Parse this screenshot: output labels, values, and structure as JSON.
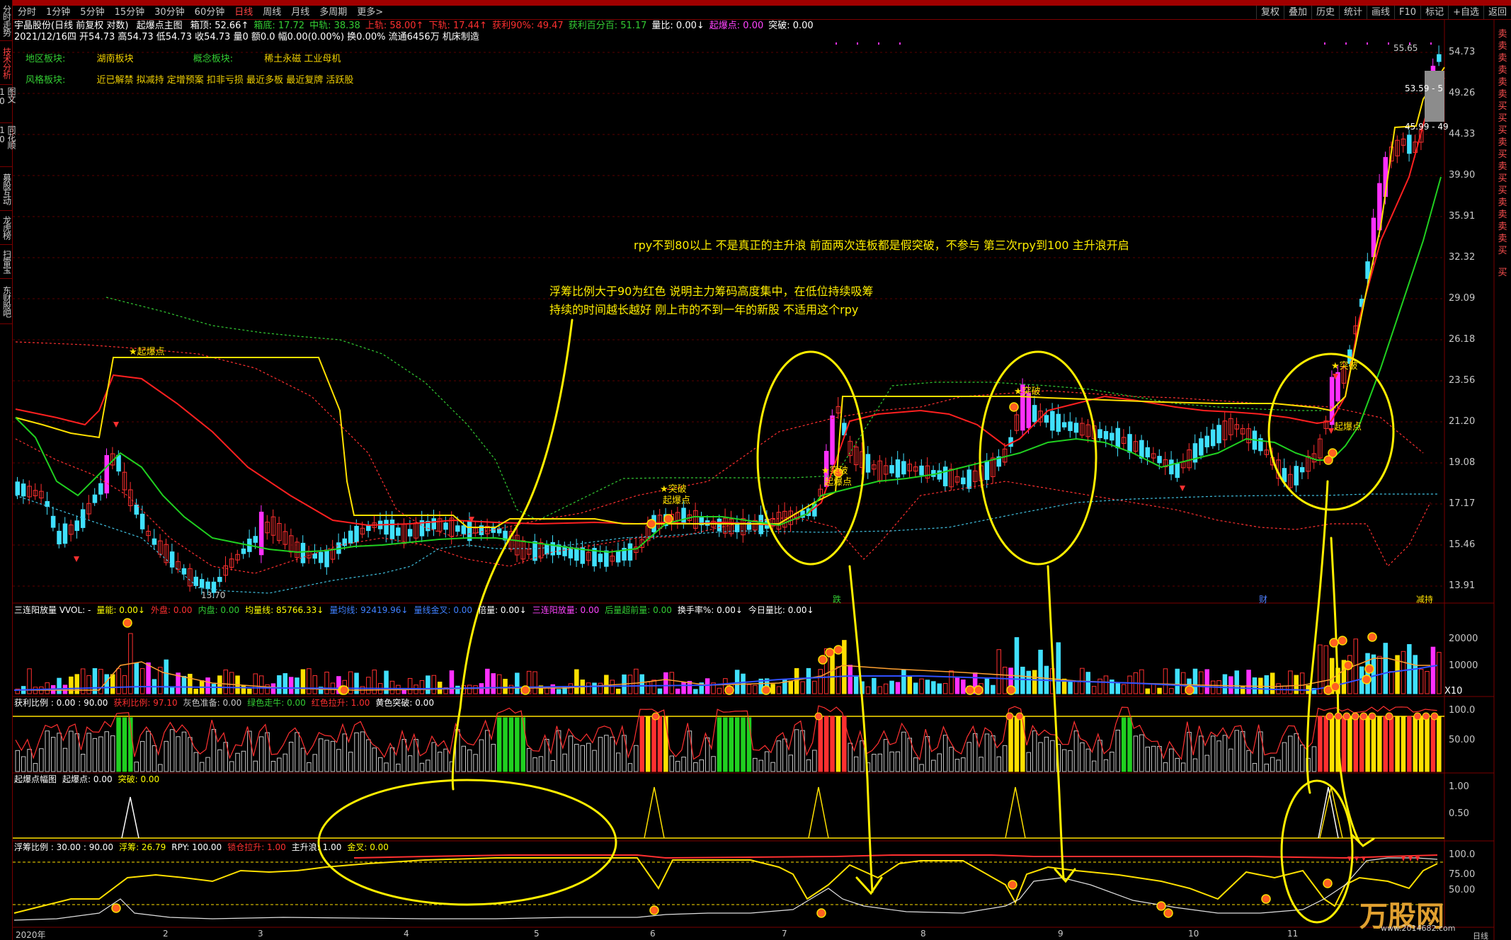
{
  "left_tabs": [
    "分时走势",
    "技术分析",
    "图文10",
    "同花顺10",
    "募股互动",
    "龙虎榜",
    "扫雷宝",
    "东财股吧"
  ],
  "periods": [
    "分时",
    "1分钟",
    "5分钟",
    "15分钟",
    "30分钟",
    "60分钟",
    "日线",
    "周线",
    "月线",
    "多周期",
    "更多>"
  ],
  "active_period": "日线",
  "tools": [
    "复权",
    "叠加",
    "历史",
    "统计",
    "画线",
    "F10",
    "标记",
    "+自选",
    "返回"
  ],
  "stock_line": {
    "name": "宇晶股份(日线 前复权 对数)",
    "indicator": "起爆点主图",
    "items": [
      {
        "text": "箱顶: 52.66↑",
        "color": "#ffffff"
      },
      {
        "text": "箱底: 17.72",
        "color": "#33cc33"
      },
      {
        "text": "中轨: 38.38",
        "color": "#33cc33"
      },
      {
        "text": "上轨: 58.00↑",
        "color": "#ff3030"
      },
      {
        "text": "下轨: 17.44↑",
        "color": "#ff3030"
      },
      {
        "text": "获利90%: 49.47",
        "color": "#ff3030"
      },
      {
        "text": "获利百分百: 51.17",
        "color": "#33cc33"
      },
      {
        "text": "量比: 0.00↓",
        "color": "#ffffff"
      },
      {
        "text": "起爆点: 0.00",
        "color": "#ff44ff"
      },
      {
        "text": "突破: 0.00",
        "color": "#ffffff"
      }
    ]
  },
  "quote_line": "2021/12/16四 开54.73 高54.73 低54.73 收54.73 量0 额0.0 幅0.00(0.00%) 换0.00% 流通6456万 机床制造",
  "sectors": {
    "region_label": "地区板块:",
    "region": "湖南板块",
    "concept_label": "概念板块:",
    "concept": "稀土永磁 工业母机",
    "style_label": "风格板块:",
    "style": "近已解禁 拟减持 定增预案 扣非亏损 最近多板 最近复牌 活跃股"
  },
  "annotations": {
    "a1": "rpy不到80以上 不是真正的主升浪 前面两次连板都是假突破，不参与 第三次rpy到100 主升浪开启",
    "a2": "浮筹比例大于90为红色 说明主力筹码高度集中，在低位持续吸筹",
    "a3": "持续的时间越长越好 刚上市的不到一年的新股 不适用这个rpy"
  },
  "price_axis": [
    "54.73",
    "49.26",
    "44.33",
    "39.90",
    "35.91",
    "32.32",
    "29.09",
    "26.18",
    "23.56",
    "21.20",
    "19.08",
    "17.17",
    "15.46",
    "13.91"
  ],
  "chart_labels": {
    "qibao1": "★起爆点",
    "tupo1": "★突破",
    "qibao2": "起爆点",
    "tupo2": "★突破",
    "qibao3": "起爆点",
    "tupo3": "★突破",
    "tupo4": "★突破",
    "qibao4": "起爆点",
    "low": "13.70",
    "high": "55.65",
    "box1": "53.59 - 5",
    "box2": "45.99 - 49",
    "die": "跌",
    "cai": "财",
    "jizhong": "减持"
  },
  "vol_panel": {
    "header": [
      {
        "text": "三连阳放量 VVOL: -",
        "color": "#ffffff"
      },
      {
        "text": "量能: 0.00↓",
        "color": "#ffff00"
      },
      {
        "text": "外盘: 0.00",
        "color": "#ff3030"
      },
      {
        "text": "内盘: 0.00",
        "color": "#33cc33"
      },
      {
        "text": "均量线: 85766.33↓",
        "color": "#ffff00"
      },
      {
        "text": "量均线: 92419.96↓",
        "color": "#4080ff"
      },
      {
        "text": "量线金叉: 0.00",
        "color": "#4080ff"
      },
      {
        "text": "倍量: 0.00↓",
        "color": "#ffffff"
      },
      {
        "text": "三连阳放量: 0.00",
        "color": "#ff44ff"
      },
      {
        "text": "后量超前量: 0.00",
        "color": "#33cc33"
      },
      {
        "text": "换手率%: 0.00↓",
        "color": "#ffffff"
      },
      {
        "text": "今日量比: 0.00↓",
        "color": "#ffffff"
      }
    ],
    "axis": [
      "20000",
      "10000"
    ],
    "unit": "X10"
  },
  "profit_panel": {
    "header": [
      {
        "text": "获利比例 : 0.00 : 90.00",
        "color": "#ffffff"
      },
      {
        "text": "获利比例: 97.10",
        "color": "#ff3030"
      },
      {
        "text": "灰色准备: 0.00",
        "color": "#c8c8c8"
      },
      {
        "text": "绿色走牛: 0.00",
        "color": "#33cc33"
      },
      {
        "text": "红色拉升: 1.00",
        "color": "#ff3030"
      },
      {
        "text": "黄色突破: 0.00",
        "color": "#ffffff"
      }
    ],
    "axis": [
      "100.0",
      "50.00"
    ]
  },
  "burst_panel": {
    "header": [
      {
        "text": "起爆点幅图",
        "color": "#ffffff"
      },
      {
        "text": "起爆点: 0.00",
        "color": "#ffffff"
      },
      {
        "text": "突破: 0.00",
        "color": "#ffff00"
      }
    ],
    "axis": [
      "1.00",
      "0.50"
    ]
  },
  "float_panel": {
    "header": [
      {
        "text": "浮筹比例 : 30.00 : 90.00",
        "color": "#ffffff"
      },
      {
        "text": "浮筹: 26.79",
        "color": "#ffff00"
      },
      {
        "text": "RPY: 100.00",
        "color": "#ffffff"
      },
      {
        "text": "锁仓拉升: 1.00",
        "color": "#ff3030"
      },
      {
        "text": "主升浪: 1.00",
        "color": "#ffffff"
      },
      {
        "text": "金叉: 0.00",
        "color": "#ffff00"
      }
    ],
    "axis": [
      "100.0",
      "75.00",
      "50.00"
    ]
  },
  "months": [
    "2020年",
    "2",
    "3",
    "4",
    "5",
    "6",
    "7",
    "8",
    "9",
    "10",
    "11"
  ],
  "right_strip": "卖卖卖卖卖卖买买买卖买卖买买卖卖卖卖买",
  "right_strip2": "买",
  "bottom_right": "日线",
  "watermark": "万股网",
  "watermark_url": "www.2014682.com"
}
